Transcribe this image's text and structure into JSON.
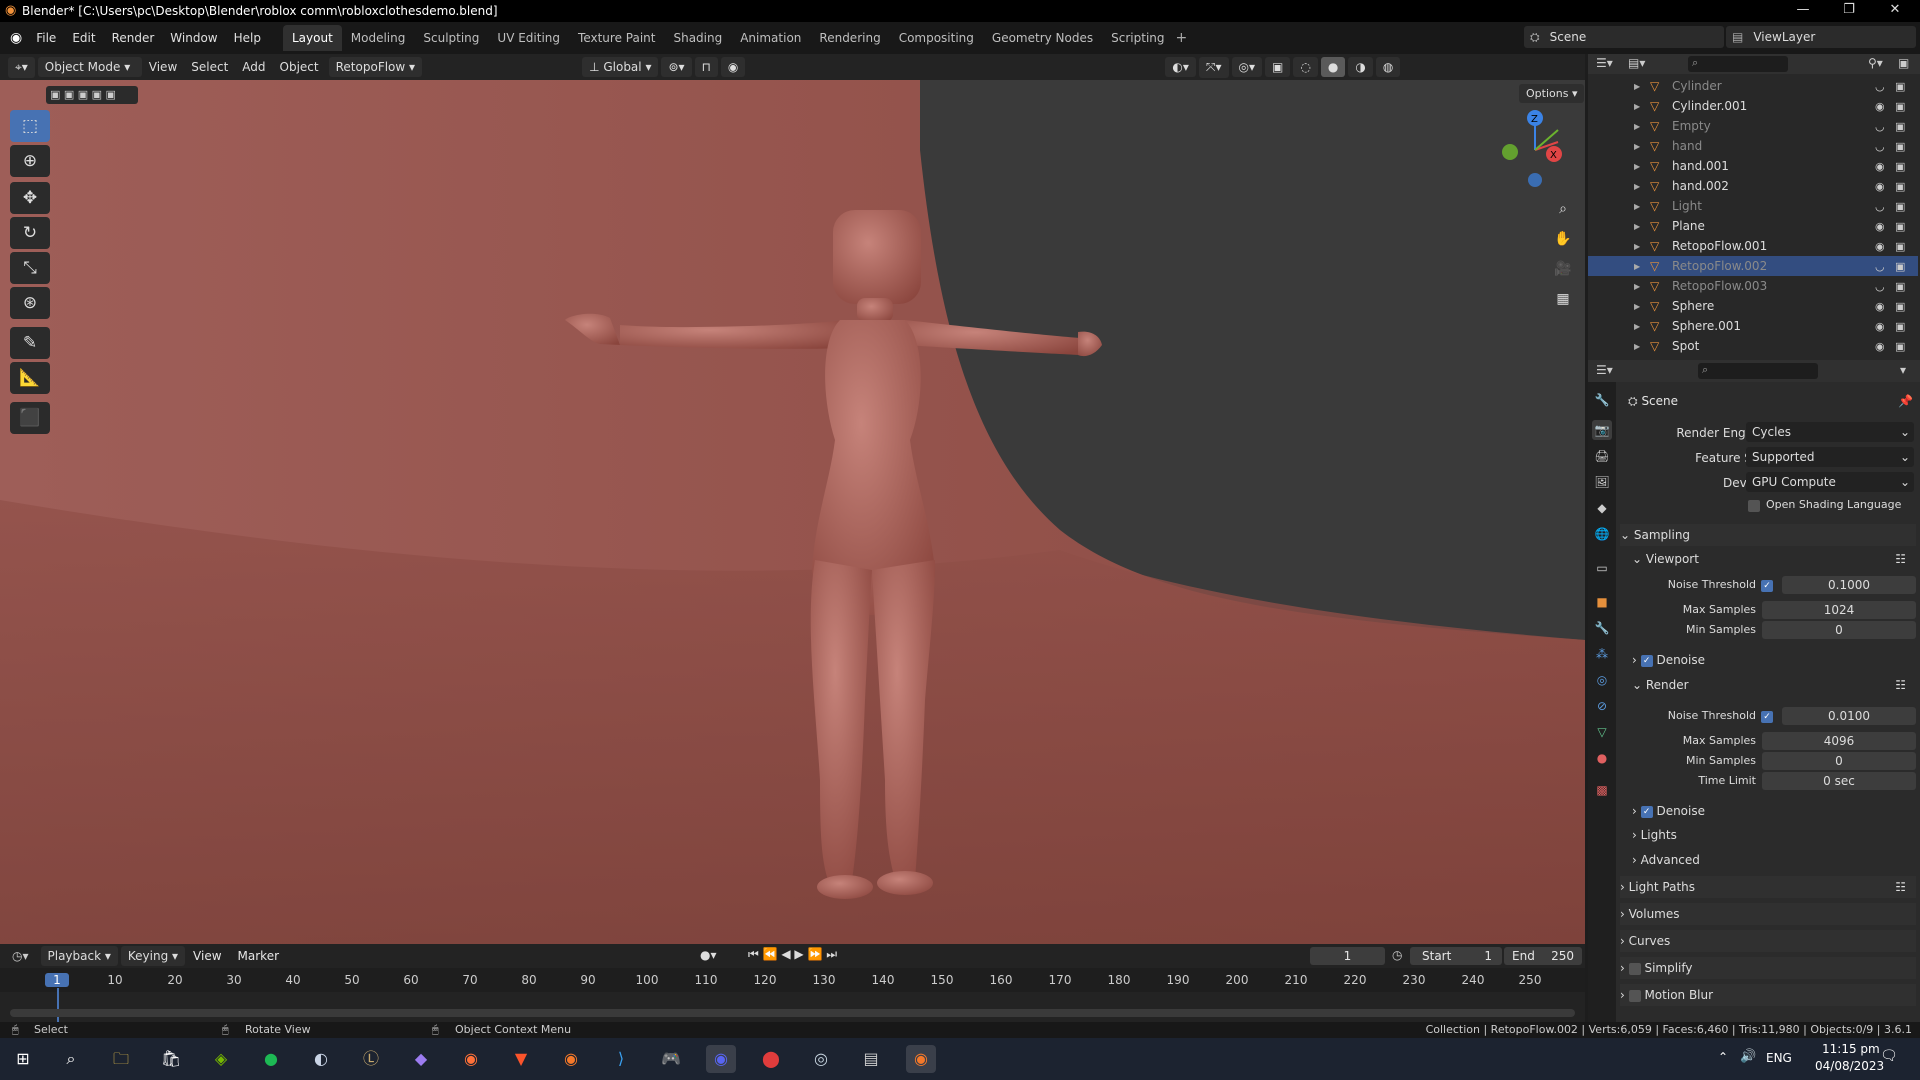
{
  "window": {
    "title": "Blender* [C:\\Users\\pc\\Desktop\\Blender\\roblox comm\\robloxclothesdemo.blend]"
  },
  "menu": [
    "File",
    "Edit",
    "Render",
    "Window",
    "Help"
  ],
  "workspaces": [
    "Layout",
    "Modeling",
    "Sculpting",
    "UV Editing",
    "Texture Paint",
    "Shading",
    "Animation",
    "Rendering",
    "Compositing",
    "Geometry Nodes",
    "Scripting"
  ],
  "scene": "Scene",
  "view_layer": "ViewLayer",
  "viewport_header": {
    "mode": "Object Mode",
    "menus": [
      "View",
      "Select",
      "Add",
      "Object"
    ],
    "addon": "RetopoFlow",
    "orientation": "Global",
    "options": "Options"
  },
  "gizmo": {
    "z": "Z",
    "x": "X"
  },
  "outliner": {
    "items": [
      {
        "name": "Cylinder",
        "dim": true
      },
      {
        "name": "Cylinder.001",
        "dim": false
      },
      {
        "name": "Empty",
        "dim": true
      },
      {
        "name": "hand",
        "dim": true
      },
      {
        "name": "hand.001",
        "dim": false
      },
      {
        "name": "hand.002",
        "dim": false
      },
      {
        "name": "Light",
        "dim": true
      },
      {
        "name": "Plane",
        "dim": false
      },
      {
        "name": "RetopoFlow.001",
        "dim": false
      },
      {
        "name": "RetopoFlow.002",
        "dim": true,
        "selected": true
      },
      {
        "name": "RetopoFlow.003",
        "dim": true
      },
      {
        "name": "Sphere",
        "dim": false
      },
      {
        "name": "Sphere.001",
        "dim": false
      },
      {
        "name": "Spot",
        "dim": false
      }
    ]
  },
  "properties": {
    "context": "Scene",
    "render_engine_label": "Render Engine",
    "render_engine": "Cycles",
    "feature_set_label": "Feature Set",
    "feature_set": "Supported",
    "device_label": "Device",
    "device": "GPU Compute",
    "osl_label": "Open Shading Language",
    "sampling": "Sampling",
    "viewport": "Viewport",
    "noise_threshold_label": "Noise Threshold",
    "viewport_noise_threshold": "0.1000",
    "max_samples_label": "Max Samples",
    "viewport_max_samples": "1024",
    "min_samples_label": "Min Samples",
    "viewport_min_samples": "0",
    "denoise_label": "Denoise",
    "render": "Render",
    "render_noise_threshold": "0.0100",
    "render_max_samples": "4096",
    "render_min_samples": "0",
    "time_limit_label": "Time Limit",
    "time_limit": "0 sec",
    "lights": "Lights",
    "advanced": "Advanced",
    "light_paths": "Light Paths",
    "volumes": "Volumes",
    "curves": "Curves",
    "simplify": "Simplify",
    "motion_blur": "Motion Blur"
  },
  "timeline": {
    "menus": [
      "Playback",
      "Keying",
      "View",
      "Marker"
    ],
    "current_frame": "1",
    "start_label": "Start",
    "start": "1",
    "end_label": "End",
    "end": "250",
    "ticks": [
      "1",
      "10",
      "20",
      "30",
      "40",
      "50",
      "60",
      "70",
      "80",
      "90",
      "100",
      "110",
      "120",
      "130",
      "140",
      "150",
      "160",
      "170",
      "180",
      "190",
      "200",
      "210",
      "220",
      "230",
      "240",
      "250"
    ]
  },
  "status": {
    "select": "Select",
    "rotate": "Rotate View",
    "context_menu": "Object Context Menu",
    "info": "Collection | RetopoFlow.002 | Verts:6,059 | Faces:6,460 | Tris:11,980 | Objects:0/9 | 3.6.1"
  },
  "taskbar": {
    "lang": "ENG",
    "time": "11:15 pm",
    "date": "04/08/2023"
  }
}
